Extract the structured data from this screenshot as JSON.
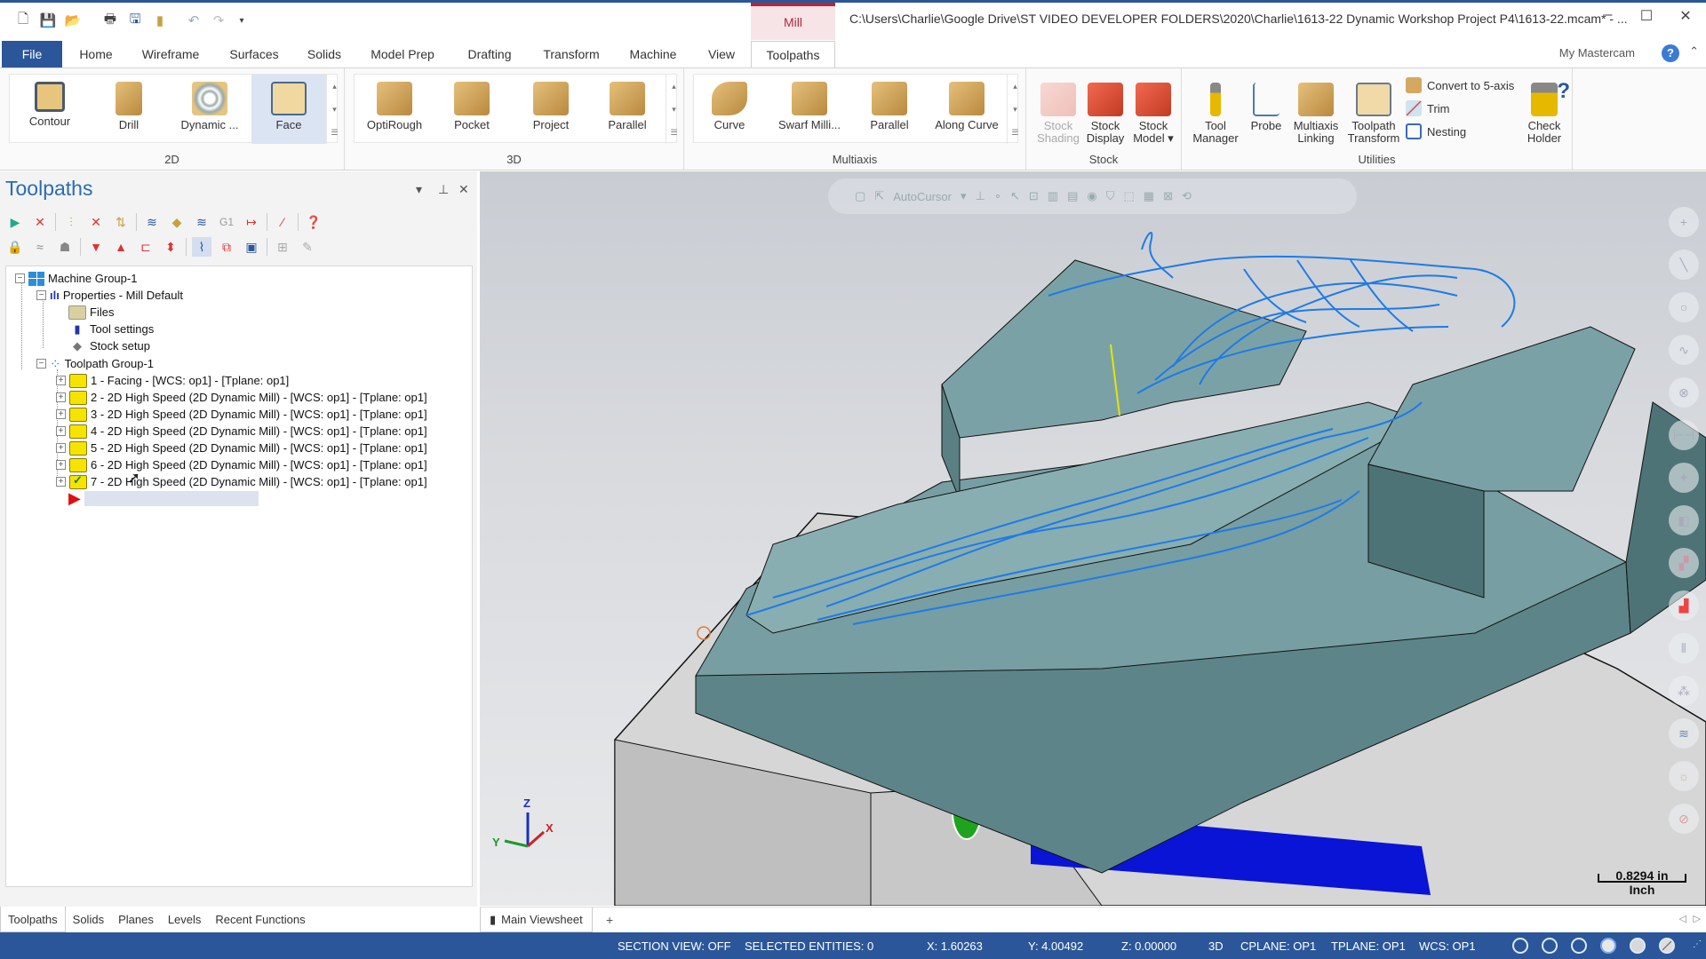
{
  "app": {
    "context_tab": "Mill",
    "title": "C:\\Users\\Charlie\\Google Drive\\ST VIDEO DEVELOPER FOLDERS\\2020\\Charlie\\1613-22 Dynamic Workshop Project P4\\1613-22.mcam* - ...",
    "window_controls": {
      "minimize": "–",
      "maximize": "☐",
      "close": "✕"
    }
  },
  "quick_access": [
    "new-file-icon",
    "save-icon",
    "open-icon",
    "print-icon",
    "save-as-icon",
    "zip2go-icon",
    "undo-icon",
    "redo-icon",
    "customize-icon"
  ],
  "ribbon_tabs": [
    {
      "label": "File"
    },
    {
      "label": "Home"
    },
    {
      "label": "Wireframe"
    },
    {
      "label": "Surfaces"
    },
    {
      "label": "Solids"
    },
    {
      "label": "Model Prep"
    },
    {
      "label": "Drafting"
    },
    {
      "label": "Transform"
    },
    {
      "label": "Machine"
    },
    {
      "label": "View"
    },
    {
      "label": "Toolpaths"
    }
  ],
  "active_tab": "Toolpaths",
  "my_mastercam": "My Mastercam",
  "help_label": "?",
  "ribbon": {
    "group_2d": {
      "label": "2D",
      "buttons": [
        "Contour",
        "Drill",
        "Dynamic ...",
        "Face"
      ],
      "selected": "Face"
    },
    "group_3d": {
      "label": "3D",
      "buttons": [
        "OptiRough",
        "Pocket",
        "Project",
        "Parallel"
      ]
    },
    "group_multiaxis": {
      "label": "Multiaxis",
      "buttons": [
        "Curve",
        "Swarf Milli...",
        "Parallel",
        "Along Curve"
      ]
    },
    "group_stock": {
      "label": "Stock",
      "buttons": [
        {
          "line1": "Stock",
          "line2": "Shading"
        },
        {
          "line1": "Stock",
          "line2": "Display"
        },
        {
          "line1": "Stock",
          "line2": "Model ▾"
        }
      ]
    },
    "group_utilities": {
      "label": "Utilities",
      "buttons": [
        {
          "line1": "Tool",
          "line2": "Manager"
        },
        {
          "line1": "Probe",
          "line2": ""
        },
        {
          "line1": "Multiaxis",
          "line2": "Linking"
        },
        {
          "line1": "Toolpath",
          "line2": "Transform"
        }
      ],
      "small_buttons": [
        "Convert to 5-axis",
        "Trim",
        "Nesting"
      ],
      "check_holder": {
        "line1": "Check",
        "line2": "Holder"
      }
    }
  },
  "toolpaths_panel": {
    "title": "Toolpaths",
    "tree": {
      "machine_group": "Machine Group-1",
      "properties": "Properties - Mill Default",
      "files": "Files",
      "tool_settings": "Tool settings",
      "stock_setup": "Stock setup",
      "toolpath_group": "Toolpath Group-1",
      "operations": [
        {
          "label": "1 - Facing - [WCS: op1] - [Tplane: op1]",
          "selected": false
        },
        {
          "label": "2 - 2D High Speed (2D Dynamic Mill) - [WCS: op1] - [Tplane: op1]",
          "selected": false
        },
        {
          "label": "3 - 2D High Speed (2D Dynamic Mill) - [WCS: op1] - [Tplane: op1]",
          "selected": false
        },
        {
          "label": "4 - 2D High Speed (2D Dynamic Mill) - [WCS: op1] - [Tplane: op1]",
          "selected": false
        },
        {
          "label": "5 - 2D High Speed (2D Dynamic Mill) - [WCS: op1] - [Tplane: op1]",
          "selected": false
        },
        {
          "label": "6 - 2D High Speed (2D Dynamic Mill) - [WCS: op1] - [Tplane: op1]",
          "selected": false
        },
        {
          "label": "7 - 2D High Speed (2D Dynamic Mill) - [WCS: op1] - [Tplane: op1]",
          "selected": true
        }
      ]
    }
  },
  "viewport": {
    "autocursor_label": "AutoCursor",
    "scale_value": "0.8294 in",
    "scale_unit": "Inch",
    "axes": {
      "x": "X",
      "y": "Y",
      "z": "Z"
    }
  },
  "bottom_tabs": [
    "Toolpaths",
    "Solids",
    "Planes",
    "Levels",
    "Recent Functions"
  ],
  "viewsheet": {
    "label": "Main Viewsheet",
    "add": "+"
  },
  "status": {
    "section_view": "SECTION VIEW: OFF",
    "selected_entities": "SELECTED ENTITIES: 0",
    "x": "X:  1.60263",
    "y": "Y:  4.00492",
    "z": "Z:  0.00000",
    "mode": "3D",
    "cplane": "CPLANE: OP1",
    "tplane": "TPLANE: OP1",
    "wcs": "WCS: OP1"
  },
  "colors": {
    "accent": "#2b579a",
    "mill_context": "#b0293a",
    "part": "#6f9599",
    "toolpath": "#1e7be6"
  }
}
